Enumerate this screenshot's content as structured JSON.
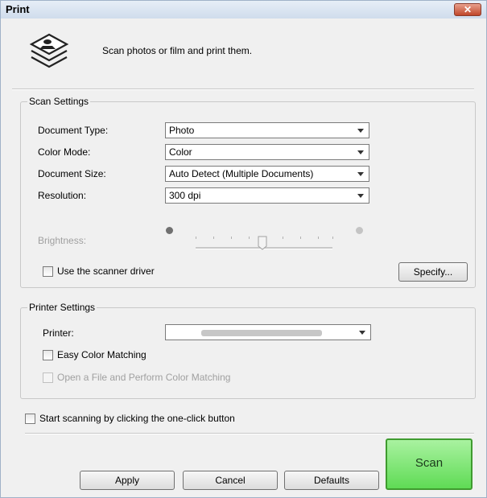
{
  "window": {
    "title": "Print",
    "close_glyph": "✕"
  },
  "header": {
    "icon": "scan-print-icon",
    "description": "Scan photos or film and print them."
  },
  "scan_settings": {
    "legend": "Scan Settings",
    "document_type": {
      "label": "Document Type:",
      "value": "Photo"
    },
    "color_mode": {
      "label": "Color Mode:",
      "value": "Color"
    },
    "document_size": {
      "label": "Document Size:",
      "value": "Auto Detect (Multiple Documents)"
    },
    "resolution": {
      "label": "Resolution:",
      "value": "300 dpi"
    },
    "brightness": {
      "label": "Brightness:",
      "enabled": false
    },
    "use_scanner_driver": {
      "label": "Use the scanner driver",
      "checked": false
    },
    "specify_button": "Specify..."
  },
  "printer_settings": {
    "legend": "Printer Settings",
    "printer": {
      "label": "Printer:"
    },
    "easy_color_matching": {
      "label": "Easy Color Matching",
      "checked": false
    },
    "open_file_color_matching": {
      "label": "Open a File and Perform Color Matching",
      "checked": false,
      "enabled": false
    }
  },
  "one_click": {
    "label": "Start scanning by clicking the one-click button",
    "checked": false
  },
  "buttons": {
    "apply": "Apply",
    "cancel": "Cancel",
    "defaults": "Defaults",
    "scan": "Scan"
  },
  "colors": {
    "scan_button": "#5fdb55",
    "close_button": "#c0472a",
    "titlebar": "#cfdcec"
  }
}
